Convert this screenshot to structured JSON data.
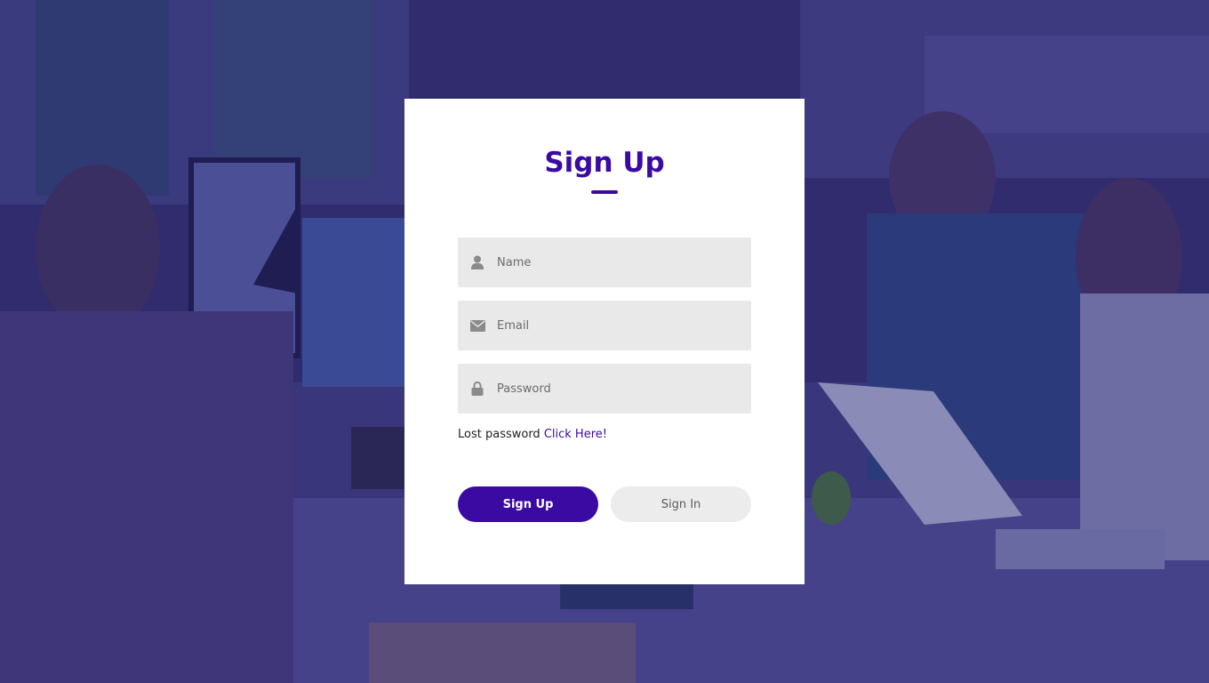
{
  "form": {
    "title": "Sign Up",
    "fields": {
      "name": {
        "placeholder": "Name",
        "value": "",
        "icon": "user-icon"
      },
      "email": {
        "placeholder": "Email",
        "value": "",
        "icon": "envelope-icon"
      },
      "password": {
        "placeholder": "Password",
        "value": "",
        "icon": "lock-icon"
      }
    },
    "lost_password": {
      "text": "Lost password",
      "link": "Click Here!"
    },
    "buttons": {
      "signup": "Sign Up",
      "signin": "Sign In"
    }
  },
  "colors": {
    "accent": "#3b0aa3",
    "overlay": "#2d2a6b",
    "field_bg": "#e9e9e9",
    "card_bg": "#ffffff"
  }
}
